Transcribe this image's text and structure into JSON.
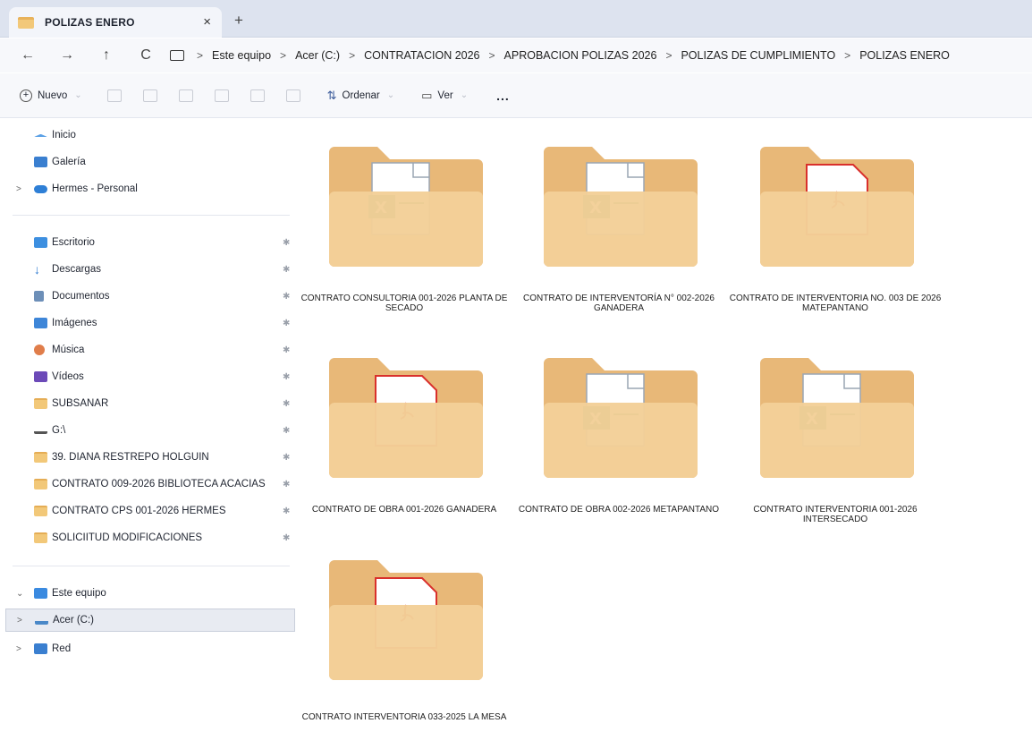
{
  "window": {
    "tab_title": "POLIZAS ENERO",
    "tab_close": "×",
    "tab_new": "+"
  },
  "address": {
    "back": "←",
    "forward": "→",
    "up": "↑",
    "refresh": "C",
    "separator": ">",
    "crumbs": [
      "Este equipo",
      "Acer (C:)",
      "CONTRATACION 2026",
      "APROBACION POLIZAS 2026",
      "POLIZAS DE CUMPLIMIENTO",
      "POLIZAS ENERO"
    ]
  },
  "toolbar": {
    "new_label": "Nuevo",
    "sort_label": "Ordenar",
    "view_label": "Ver",
    "more_label": "..."
  },
  "sidebar": {
    "items": [
      {
        "label": "Inicio",
        "icon": "home-icon"
      },
      {
        "label": "Galería",
        "icon": "gallery-icon"
      },
      {
        "label": "Hermes - Personal",
        "icon": "cloud-icon"
      },
      {
        "label": "Escritorio",
        "icon": "desktop-icon"
      },
      {
        "label": "Descargas",
        "icon": "download-icon"
      },
      {
        "label": "Documentos",
        "icon": "documents-icon"
      },
      {
        "label": "Imágenes",
        "icon": "pictures-icon"
      },
      {
        "label": "Música",
        "icon": "music-icon"
      },
      {
        "label": "Vídeos",
        "icon": "videos-icon"
      },
      {
        "label": "SUBSANAR",
        "icon": "folder-icon"
      },
      {
        "label": "G:\\",
        "icon": "drive-icon"
      },
      {
        "label": "39. DIANA RESTREPO HOLGUIN",
        "icon": "folder-icon"
      },
      {
        "label": "CONTRATO 009-2026 BIBLIOTECA ACACIAS",
        "icon": "folder-icon"
      },
      {
        "label": "CONTRATO CPS 001-2026 HERMES",
        "icon": "folder-icon"
      },
      {
        "label": "SOLICIITUD MODIFICACIONES",
        "icon": "folder-icon"
      },
      {
        "label": "Este equipo",
        "icon": "this-pc-icon"
      },
      {
        "label": "Acer (C:)",
        "icon": "disk-icon"
      },
      {
        "label": "Red",
        "icon": "network-icon"
      }
    ]
  },
  "folders": [
    {
      "name": "CONTRATO CONSULTORIA 001-2026 PLANTA DE SECADO",
      "preview": "excel"
    },
    {
      "name": "CONTRATO DE INTERVENTORÍA N° 002-2026 GANADERA",
      "preview": "excel"
    },
    {
      "name": "CONTRATO DE INTERVENTORIA No. 003 DE 2026 MATEPANTANO",
      "preview": "pdf"
    },
    {
      "name": "CONTRATO DE OBRA  001-2026 GANADERA",
      "preview": "pdf"
    },
    {
      "name": "CONTRATO DE OBRA 002-2026 METAPANTANO",
      "preview": "excel"
    },
    {
      "name": "CONTRATO INTERVENTORIA 001-2026 INTERSECADO",
      "preview": "excel"
    },
    {
      "name": "CONTRATO INTERVENTORIA 033-2025 LA MESA",
      "preview": "pdf"
    }
  ],
  "colors": {
    "folder_back": "#e8b878",
    "folder_front": "#f3cf98",
    "excel_green": "#1d7a55",
    "pdf_red": "#d9302c",
    "selection": "#e8ebf2"
  }
}
